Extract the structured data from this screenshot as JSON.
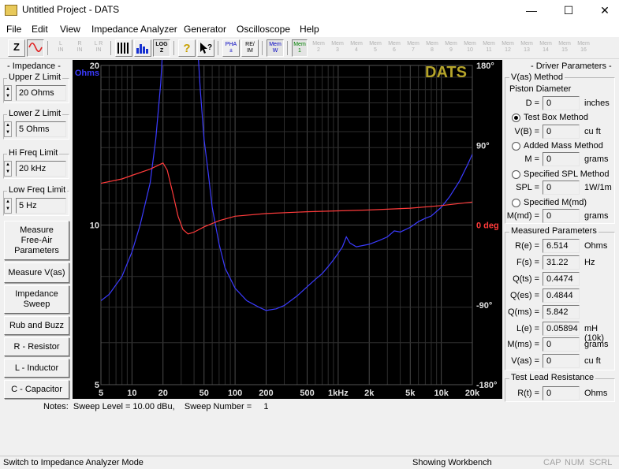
{
  "window": {
    "title": "Untitled Project - DATS",
    "minimize_glyph": "—",
    "maximize_glyph": "☐",
    "close_glyph": "✕"
  },
  "menu": [
    "File",
    "Edit",
    "View",
    "Impedance Analyzer",
    "Generator",
    "Oscilloscope",
    "Help"
  ],
  "toolbar": {
    "z_label": "Z",
    "l_in": [
      "L",
      "IN"
    ],
    "r_in": [
      "R",
      "IN"
    ],
    "lr_in": [
      "L R",
      "IN"
    ],
    "log_z": [
      "LOG",
      "Z"
    ],
    "pha": [
      "PHA",
      "±"
    ],
    "re_im": [
      "RE/",
      "IM"
    ],
    "mem_w": [
      "Mem",
      "W"
    ],
    "mem_slots": [
      "1",
      "2",
      "3",
      "4",
      "5",
      "6",
      "7",
      "8",
      "9",
      "10",
      "11",
      "12",
      "13",
      "14",
      "15",
      "16"
    ],
    "mem_label": "Mem"
  },
  "left_panel": {
    "impedance_header": "- Impedance -",
    "upper_z": {
      "label": "Upper Z Limit",
      "value": "20 Ohms"
    },
    "lower_z": {
      "label": "Lower Z Limit",
      "value": "5 Ohms"
    },
    "hi_freq": {
      "label": "Hi Freq Limit",
      "value": "20 kHz"
    },
    "low_freq": {
      "label": "Low Freq Limit",
      "value": "5 Hz"
    },
    "buttons": [
      "Measure\nFree-Air\nParameters",
      "Measure V(as)",
      "Impedance\nSweep",
      "Rub and Buzz",
      "R - Resistor",
      "L - Inductor",
      "C - Capacitor"
    ]
  },
  "graph": {
    "watermark": "DATS",
    "y_unit": "Ohms",
    "y_ticks": [
      "20",
      "10",
      "5"
    ],
    "phase_ticks": [
      "180°",
      "90°",
      "0 deg",
      "-90°",
      "-180°"
    ],
    "x_ticks": [
      "5",
      "10",
      "20",
      "50",
      "100",
      "200",
      "500",
      "1kHz",
      "2k",
      "5k",
      "10k",
      "20k"
    ],
    "colors": {
      "background": "#000000",
      "impedance": "#3b3bff",
      "phase": "#ff3b3b",
      "watermark": "#b5a42a",
      "grid": "#3a3a3a"
    }
  },
  "chart_data": {
    "type": "line",
    "xlabel": "",
    "ylabel": "Ohms",
    "x_scale": "log",
    "y_scale": "log",
    "xlim": [
      5,
      20000
    ],
    "ylim": [
      5,
      20
    ],
    "y2lim": [
      -180,
      180
    ],
    "y2label": "deg",
    "series": [
      {
        "name": "Impedance",
        "x": [
          5,
          6,
          8,
          10,
          12,
          15,
          17,
          19,
          20,
          21,
          23,
          25,
          28,
          30,
          31.2,
          33,
          35,
          38,
          42,
          46,
          50,
          55,
          60,
          70,
          80,
          100,
          130,
          170,
          200,
          250,
          300,
          400,
          500,
          600,
          700,
          800,
          900,
          1000,
          1100,
          1200,
          1300,
          1500,
          2000,
          2500,
          3000,
          3500,
          4000,
          5000,
          6000,
          7000,
          8000,
          10000,
          12000,
          15000,
          18000,
          20000
        ],
        "values": [
          7.2,
          7.4,
          8.0,
          8.9,
          10.0,
          12.0,
          14.5,
          18.5,
          22,
          28,
          40,
          60,
          80,
          95,
          100,
          90,
          60,
          38,
          24,
          18,
          14.5,
          12.5,
          10.8,
          9.2,
          8.3,
          7.6,
          7.2,
          7.0,
          6.9,
          6.95,
          7.05,
          7.35,
          7.65,
          7.9,
          8.1,
          8.35,
          8.6,
          8.85,
          9.1,
          9.5,
          9.25,
          9.1,
          9.2,
          9.35,
          9.5,
          9.75,
          9.7,
          9.9,
          10.15,
          10.3,
          10.4,
          10.8,
          11.3,
          12.1,
          13.0,
          13.6
        ]
      },
      {
        "name": "Phase",
        "axis": "right",
        "x": [
          5,
          8,
          10,
          15,
          20,
          22,
          25,
          28,
          31.2,
          35,
          40,
          50,
          70,
          100,
          200,
          500,
          1000,
          2000,
          5000,
          10000,
          20000
        ],
        "values": [
          47,
          52,
          56,
          63,
          70,
          62,
          35,
          10,
          -5,
          -10,
          -8,
          -2,
          5,
          10,
          13,
          15,
          16,
          17,
          19,
          22,
          26
        ]
      }
    ]
  },
  "right_panel": {
    "header": "- Driver Parameters -",
    "vas_method": "V(as) Method",
    "piston_diameter": "Piston Diameter",
    "d_label": "D =",
    "d_value": "0",
    "d_unit": "inches",
    "test_box": "Test Box Method",
    "vb_label": "V(B) =",
    "vb_value": "0",
    "vb_unit": "cu ft",
    "added_mass": "Added Mass Method",
    "m_label": "M =",
    "m_value": "0",
    "m_unit": "grams",
    "spl_method": "Specified SPL Method",
    "spl_label": "SPL =",
    "spl_value": "0",
    "spl_unit": "1W/1m",
    "mmd_method": "Specified M(md)",
    "mmd_label": "M(md) =",
    "mmd_value": "0",
    "mmd_unit": "grams",
    "measured_header": "Measured Parameters",
    "measured": [
      {
        "label": "R(e) =",
        "value": "6.514",
        "unit": "Ohms"
      },
      {
        "label": "F(s) =",
        "value": "31.22",
        "unit": "Hz"
      },
      {
        "label": "Q(ts) =",
        "value": "0.4474",
        "unit": ""
      },
      {
        "label": "Q(es) =",
        "value": "0.4844",
        "unit": ""
      },
      {
        "label": "Q(ms) =",
        "value": "5.842",
        "unit": ""
      },
      {
        "label": "L(e) =",
        "value": "0.05894",
        "unit": "mH (10k)"
      },
      {
        "label": "M(ms) =",
        "value": "0",
        "unit": "grams"
      },
      {
        "label": "V(as) =",
        "value": "0",
        "unit": "cu ft"
      }
    ],
    "lead_header": "Test Lead Resistance",
    "rt_label": "R(t) =",
    "rt_value": "0",
    "rt_unit": "Ohms"
  },
  "notes": "Notes:  Sweep Level = 10.00 dBu,    Sweep Number =     1",
  "status": {
    "left": "Switch to Impedance Analyzer Mode",
    "middle": "Showing Workbench",
    "cap": "CAP",
    "num": "NUM",
    "scrl": "SCRL"
  }
}
